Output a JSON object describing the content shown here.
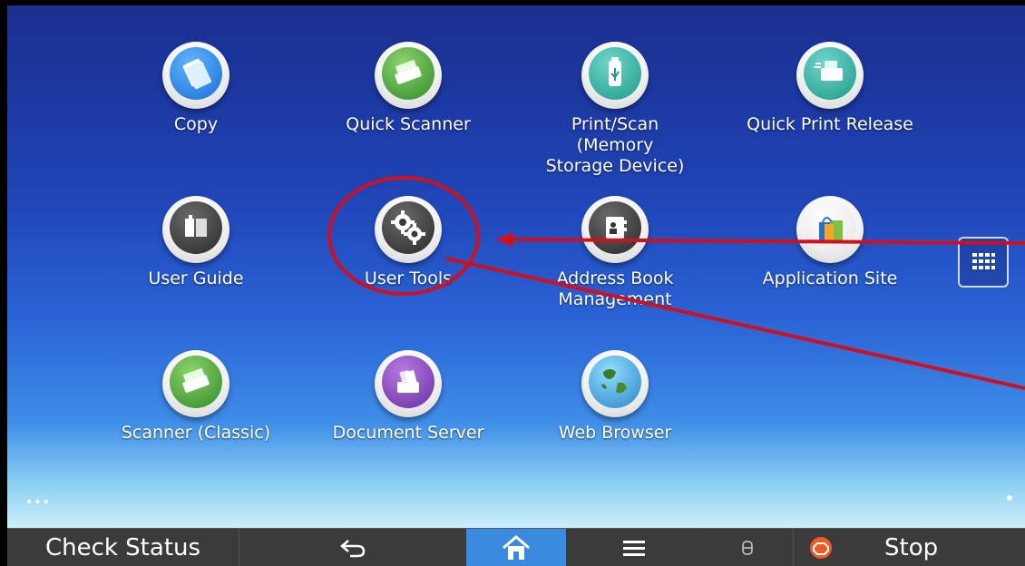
{
  "apps": [
    {
      "id": "copy",
      "label": "Copy"
    },
    {
      "id": "quick-scanner",
      "label": "Quick Scanner"
    },
    {
      "id": "print-scan-memory",
      "label": "Print/Scan (Memory\nStorage Device)"
    },
    {
      "id": "quick-print-release",
      "label": "Quick Print Release"
    },
    {
      "id": "user-guide",
      "label": "User Guide"
    },
    {
      "id": "user-tools",
      "label": "User Tools"
    },
    {
      "id": "address-book",
      "label": "Address Book\nManagement"
    },
    {
      "id": "application-site",
      "label": "Application Site"
    },
    {
      "id": "scanner-classic",
      "label": "Scanner (Classic)"
    },
    {
      "id": "document-server",
      "label": "Document Server"
    },
    {
      "id": "web-browser",
      "label": "Web Browser"
    }
  ],
  "bottom_bar": {
    "check_status": "Check Status",
    "stop": "Stop"
  },
  "page_indicator": "•••",
  "colors": {
    "annotation_red": "#d0101e",
    "home_active": "#3a8be0",
    "stop_orange": "#f05a28"
  }
}
